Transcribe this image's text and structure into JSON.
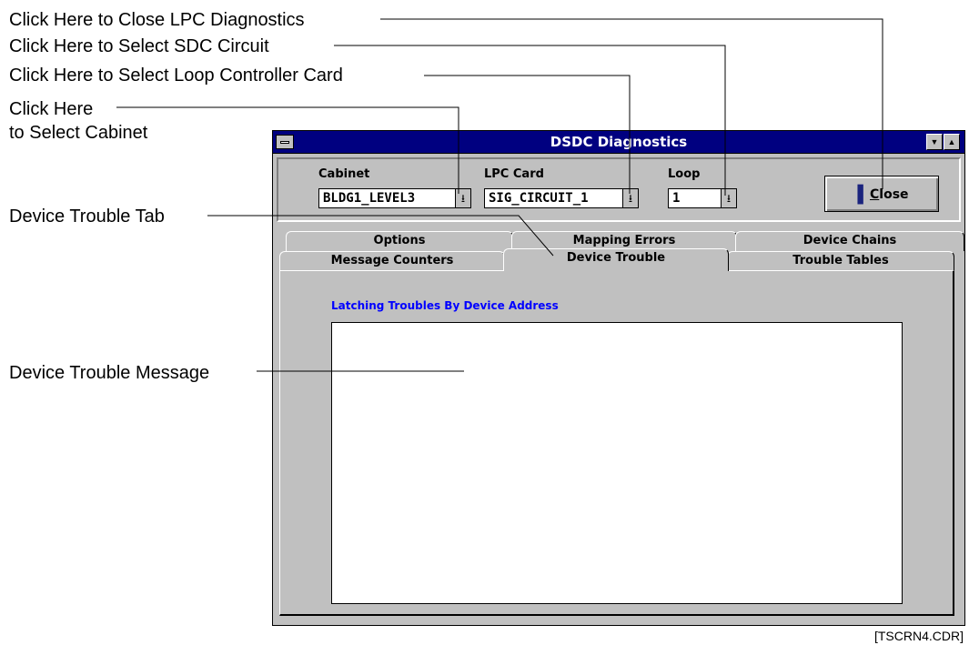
{
  "callouts": {
    "close": "Click Here to Close LPC Diagnostics",
    "sdc": "Click Here to Select SDC Circuit",
    "loop_card": "Click Here to Select Loop Controller Card",
    "cabinet_line1": "Click Here",
    "cabinet_line2": "to Select Cabinet",
    "device_tab": "Device Trouble Tab",
    "device_msg": "Device Trouble Message"
  },
  "window": {
    "title": "DSDC Diagnostics",
    "cabinet": {
      "label": "Cabinet",
      "value": "BLDG1_LEVEL3"
    },
    "lpc_card": {
      "label": "LPC Card",
      "value": "SIG_CIRCUIT_1"
    },
    "loop": {
      "label": "Loop",
      "value": "1"
    },
    "close_button": {
      "accel": "C",
      "rest": "lose"
    },
    "tabs_back": [
      "Options",
      "Mapping Errors",
      "Device Chains"
    ],
    "tabs_front": [
      "Message Counters",
      "Device Trouble",
      "Trouble Tables"
    ],
    "active_tab": "Device Trouble",
    "list_title": "Latching Troubles By Device Address"
  },
  "footer": "[TSCRN4.CDR]"
}
